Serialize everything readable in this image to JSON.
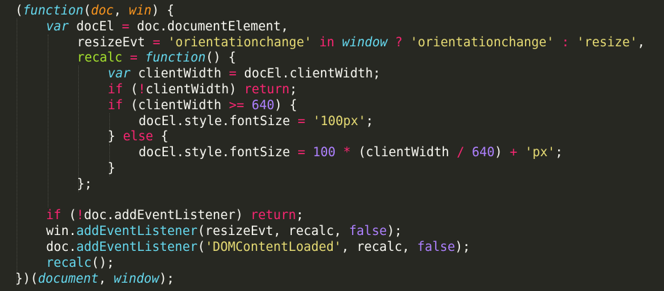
{
  "editor": {
    "theme": {
      "background": "#272822",
      "plain": "#F8F8F2",
      "storage": "#66D9EF",
      "keyword": "#F92672",
      "string": "#E6DB74",
      "number": "#AE81FF",
      "parameter": "#FD971F",
      "entity": "#A6E22E"
    },
    "lines": [
      {
        "indent": 0,
        "tokens": [
          {
            "t": "(",
            "c": "plain"
          },
          {
            "t": "function",
            "c": "storage"
          },
          {
            "t": "(",
            "c": "plain"
          },
          {
            "t": "doc",
            "c": "param"
          },
          {
            "t": ", ",
            "c": "plain"
          },
          {
            "t": "win",
            "c": "param"
          },
          {
            "t": ") {",
            "c": "plain"
          }
        ]
      },
      {
        "indent": 1,
        "tokens": [
          {
            "t": "var",
            "c": "storage"
          },
          {
            "t": " docEl ",
            "c": "plain"
          },
          {
            "t": "=",
            "c": "op"
          },
          {
            "t": " doc.documentElement,",
            "c": "plain"
          }
        ]
      },
      {
        "indent": 2,
        "tokens": [
          {
            "t": "resizeEvt ",
            "c": "plain"
          },
          {
            "t": "=",
            "c": "op"
          },
          {
            "t": " ",
            "c": "plain"
          },
          {
            "t": "'orientationchange'",
            "c": "string"
          },
          {
            "t": " ",
            "c": "plain"
          },
          {
            "t": "in",
            "c": "kw"
          },
          {
            "t": " ",
            "c": "plain"
          },
          {
            "t": "window",
            "c": "storage"
          },
          {
            "t": " ",
            "c": "plain"
          },
          {
            "t": "?",
            "c": "op"
          },
          {
            "t": " ",
            "c": "plain"
          },
          {
            "t": "'orientationchange'",
            "c": "string"
          },
          {
            "t": " ",
            "c": "plain"
          },
          {
            "t": ":",
            "c": "op"
          },
          {
            "t": " ",
            "c": "plain"
          },
          {
            "t": "'resize'",
            "c": "string"
          },
          {
            "t": ",",
            "c": "plain"
          }
        ]
      },
      {
        "indent": 2,
        "tokens": [
          {
            "t": "recalc",
            "c": "entity"
          },
          {
            "t": " ",
            "c": "plain"
          },
          {
            "t": "=",
            "c": "op"
          },
          {
            "t": " ",
            "c": "plain"
          },
          {
            "t": "function",
            "c": "storage"
          },
          {
            "t": "() {",
            "c": "plain"
          }
        ]
      },
      {
        "indent": 3,
        "tokens": [
          {
            "t": "var",
            "c": "storage"
          },
          {
            "t": " clientWidth ",
            "c": "plain"
          },
          {
            "t": "=",
            "c": "op"
          },
          {
            "t": " docEl.clientWidth;",
            "c": "plain"
          }
        ]
      },
      {
        "indent": 3,
        "tokens": [
          {
            "t": "if",
            "c": "kw"
          },
          {
            "t": " (",
            "c": "plain"
          },
          {
            "t": "!",
            "c": "op"
          },
          {
            "t": "clientWidth) ",
            "c": "plain"
          },
          {
            "t": "return",
            "c": "kw"
          },
          {
            "t": ";",
            "c": "plain"
          }
        ]
      },
      {
        "indent": 3,
        "tokens": [
          {
            "t": "if",
            "c": "kw"
          },
          {
            "t": " (clientWidth ",
            "c": "plain"
          },
          {
            "t": ">=",
            "c": "op"
          },
          {
            "t": " ",
            "c": "plain"
          },
          {
            "t": "640",
            "c": "number"
          },
          {
            "t": ") {",
            "c": "plain"
          }
        ]
      },
      {
        "indent": 4,
        "tokens": [
          {
            "t": "docEl.style.fontSize ",
            "c": "plain"
          },
          {
            "t": "=",
            "c": "op"
          },
          {
            "t": " ",
            "c": "plain"
          },
          {
            "t": "'100px'",
            "c": "string"
          },
          {
            "t": ";",
            "c": "plain"
          }
        ]
      },
      {
        "indent": 3,
        "tokens": [
          {
            "t": "} ",
            "c": "plain"
          },
          {
            "t": "else",
            "c": "kw"
          },
          {
            "t": " {",
            "c": "plain"
          }
        ]
      },
      {
        "indent": 4,
        "tokens": [
          {
            "t": "docEl.style.fontSize ",
            "c": "plain"
          },
          {
            "t": "=",
            "c": "op"
          },
          {
            "t": " ",
            "c": "plain"
          },
          {
            "t": "100",
            "c": "number"
          },
          {
            "t": " ",
            "c": "plain"
          },
          {
            "t": "*",
            "c": "op"
          },
          {
            "t": " (clientWidth ",
            "c": "plain"
          },
          {
            "t": "/",
            "c": "op"
          },
          {
            "t": " ",
            "c": "plain"
          },
          {
            "t": "640",
            "c": "number"
          },
          {
            "t": ") ",
            "c": "plain"
          },
          {
            "t": "+",
            "c": "op"
          },
          {
            "t": " ",
            "c": "plain"
          },
          {
            "t": "'px'",
            "c": "string"
          },
          {
            "t": ";",
            "c": "plain"
          }
        ]
      },
      {
        "indent": 3,
        "tokens": [
          {
            "t": "}",
            "c": "plain"
          }
        ]
      },
      {
        "indent": 2,
        "tokens": [
          {
            "t": "};",
            "c": "plain"
          }
        ]
      },
      {
        "indent": 0,
        "tokens": []
      },
      {
        "indent": 1,
        "tokens": [
          {
            "t": "if",
            "c": "kw"
          },
          {
            "t": " (",
            "c": "plain"
          },
          {
            "t": "!",
            "c": "op"
          },
          {
            "t": "doc.addEventListener) ",
            "c": "plain"
          },
          {
            "t": "return",
            "c": "kw"
          },
          {
            "t": ";",
            "c": "plain"
          }
        ]
      },
      {
        "indent": 1,
        "tokens": [
          {
            "t": "win.",
            "c": "plain"
          },
          {
            "t": "addEventListener",
            "c": "call"
          },
          {
            "t": "(resizeEvt, recalc, ",
            "c": "plain"
          },
          {
            "t": "false",
            "c": "const"
          },
          {
            "t": ");",
            "c": "plain"
          }
        ]
      },
      {
        "indent": 1,
        "tokens": [
          {
            "t": "doc.",
            "c": "plain"
          },
          {
            "t": "addEventListener",
            "c": "call"
          },
          {
            "t": "(",
            "c": "plain"
          },
          {
            "t": "'DOMContentLoaded'",
            "c": "string"
          },
          {
            "t": ", recalc, ",
            "c": "plain"
          },
          {
            "t": "false",
            "c": "const"
          },
          {
            "t": ");",
            "c": "plain"
          }
        ]
      },
      {
        "indent": 1,
        "tokens": [
          {
            "t": "recalc",
            "c": "call"
          },
          {
            "t": "();",
            "c": "plain"
          }
        ]
      },
      {
        "indent": 0,
        "tokens": [
          {
            "t": "})(",
            "c": "plain"
          },
          {
            "t": "document",
            "c": "storage"
          },
          {
            "t": ", ",
            "c": "plain"
          },
          {
            "t": "window",
            "c": "storage"
          },
          {
            "t": ");",
            "c": "plain"
          }
        ]
      }
    ],
    "indent_guides": [
      {
        "level": 1,
        "from_line": 1,
        "to_line": 17
      },
      {
        "level": 2,
        "from_line": 2,
        "to_line": 12
      },
      {
        "level": 3,
        "from_line": 4,
        "to_line": 11
      },
      {
        "level": 4,
        "from_line": 7,
        "to_line": 8
      },
      {
        "level": 4,
        "from_line": 9,
        "to_line": 10
      }
    ]
  }
}
